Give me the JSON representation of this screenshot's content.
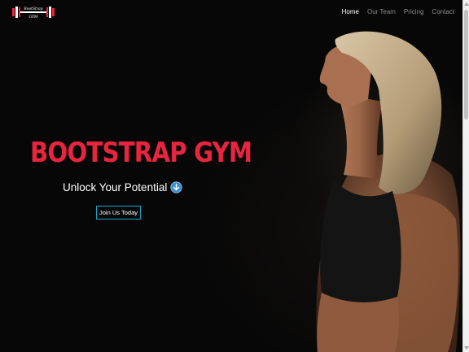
{
  "navbar": {
    "logo_text_top": "BootStrap",
    "logo_text_bottom": "GYM",
    "links": [
      {
        "label": "Home",
        "active": true
      },
      {
        "label": "Our Team",
        "active": false
      },
      {
        "label": "Pricing",
        "active": false
      },
      {
        "label": "Contact",
        "active": false
      }
    ]
  },
  "hero": {
    "title": "BOOTSTRAP GYM",
    "subtitle": "Unlock Your Potential",
    "cta_label": "Join Us Today",
    "title_color": "#e8253f",
    "accent_color": "#1aa6c8"
  },
  "icons": {
    "logo": "barbell-logo-icon",
    "subtitle_icon": "arrow-down-circle-icon"
  }
}
